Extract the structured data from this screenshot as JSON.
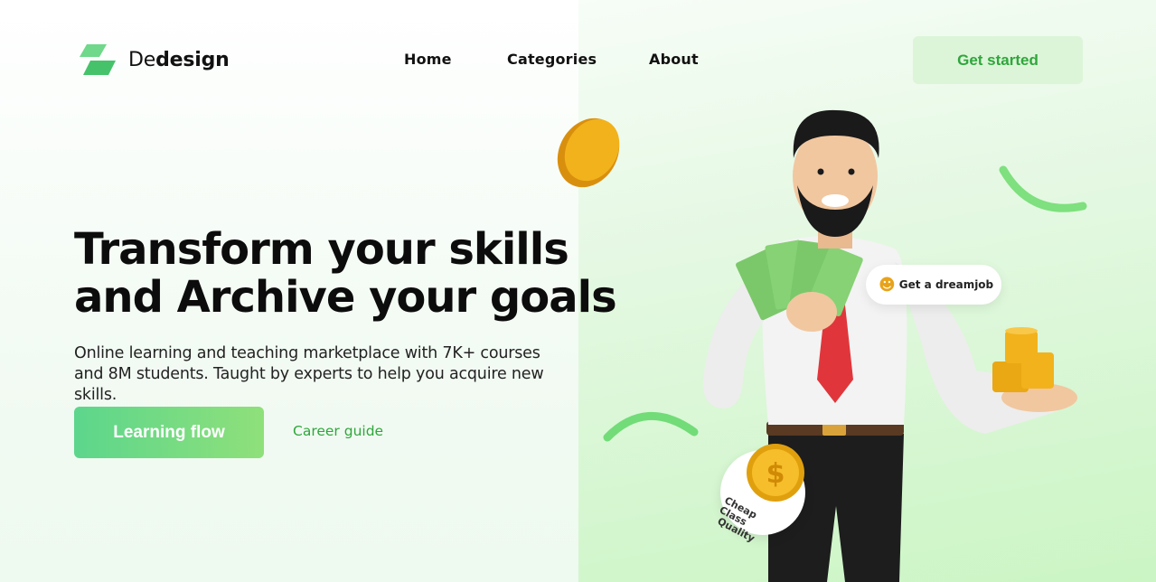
{
  "brand": {
    "prefix": "De",
    "name": "design"
  },
  "nav": {
    "items": [
      {
        "label": "Home"
      },
      {
        "label": "Categories"
      },
      {
        "label": "About"
      }
    ]
  },
  "header": {
    "cta_label": "Get started"
  },
  "hero": {
    "title_line1": "Transform your skills",
    "title_line2": "and Archive your goals",
    "subtitle": "Online learning and teaching marketplace with 7K+ courses and 8M students. Taught by experts to help you acquire new skills.",
    "primary_button": "Learning flow",
    "secondary_link": "Career guide"
  },
  "illustration": {
    "badge_dream": "Get a dreamjob",
    "seal_line1": "Cheap Class",
    "seal_line2": "Quality",
    "coin_symbol": "$"
  },
  "colors": {
    "accent": "#2fa63c",
    "accent_light": "#dcf5d8",
    "button_from": "#5cd68c",
    "button_to": "#8fe07a"
  }
}
